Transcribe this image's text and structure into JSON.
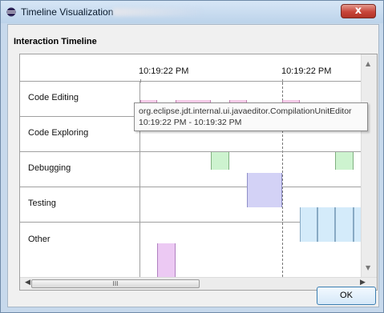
{
  "window": {
    "title": "Timeline Visualization",
    "close_label": "x"
  },
  "section": {
    "title": "Interaction Timeline"
  },
  "timeline": {
    "time_labels": [
      "10:19:22 PM",
      "10:19:22 PM"
    ],
    "rows": [
      "Code Editing",
      "Code Exploring",
      "Debugging",
      "Testing",
      "Other"
    ]
  },
  "tooltip": {
    "line1": "org.eclipse.jdt.internal.ui.javaeditor.CompilationUnitEditor",
    "line2": "10:19:22 PM - 10:19:32 PM"
  },
  "hscroll": {
    "thumb_label": "III"
  },
  "buttons": {
    "ok": "OK"
  },
  "colors": {
    "code_editing": "#f5cbe8",
    "code_exploring": "#cdf3cf",
    "debugging": "#d3d2f6",
    "testing": "#d4ebfa",
    "other": "#ecc9f3"
  },
  "icons": {
    "app": "eclipse-icon",
    "close": "close-icon"
  }
}
